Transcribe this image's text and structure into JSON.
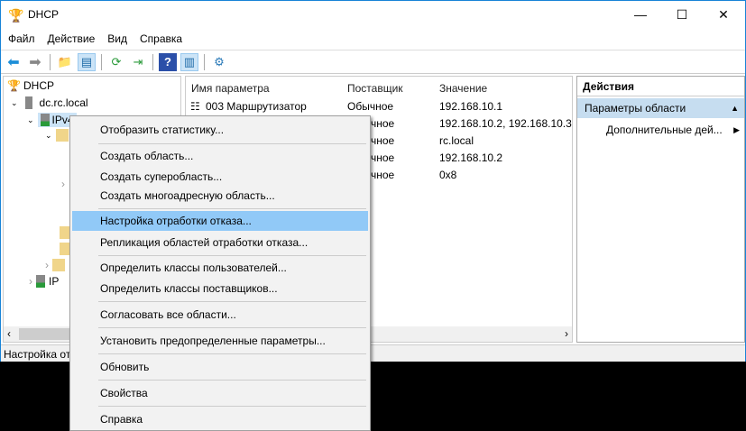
{
  "window": {
    "title": "DHCP",
    "minimize": "—",
    "maximize": "☐",
    "close": "✕"
  },
  "menu": [
    "Файл",
    "Действие",
    "Вид",
    "Справка"
  ],
  "tree": {
    "root": "DHCP",
    "server": "dc.rc.local",
    "ipv4": "IPv4",
    "ipv6": "IP"
  },
  "columns": [
    "Имя параметра",
    "Поставщик",
    "Значение"
  ],
  "rows": [
    {
      "name": "003 Маршрутизатор",
      "vendor": "Обычное",
      "value": "192.168.10.1"
    },
    {
      "name": "",
      "vendor": "чное",
      "value": "192.168.10.2, 192.168.10.3"
    },
    {
      "name": "",
      "vendor": "чное",
      "value": "rc.local"
    },
    {
      "name": "",
      "vendor": "чное",
      "value": "192.168.10.2"
    },
    {
      "name": "",
      "vendor": "чное",
      "value": "0x8"
    }
  ],
  "actions": {
    "title": "Действия",
    "section": "Параметры области",
    "more": "Дополнительные дей..."
  },
  "status": "Настройка от",
  "context_menu": [
    "Отобразить статистику...",
    "Создать область...",
    "Создать суперобласть...",
    "Создать многоадресную область...",
    "Настройка отработки отказа...",
    "Репликация областей отработки отказа...",
    "Определить классы пользователей...",
    "Определить классы поставщиков...",
    "Согласовать все области...",
    "Установить предопределенные параметры...",
    "Обновить",
    "Свойства",
    "Справка"
  ],
  "colors": {
    "highlight": "#91c9f7",
    "accent": "#1883d7",
    "section": "#c6ddf0"
  }
}
